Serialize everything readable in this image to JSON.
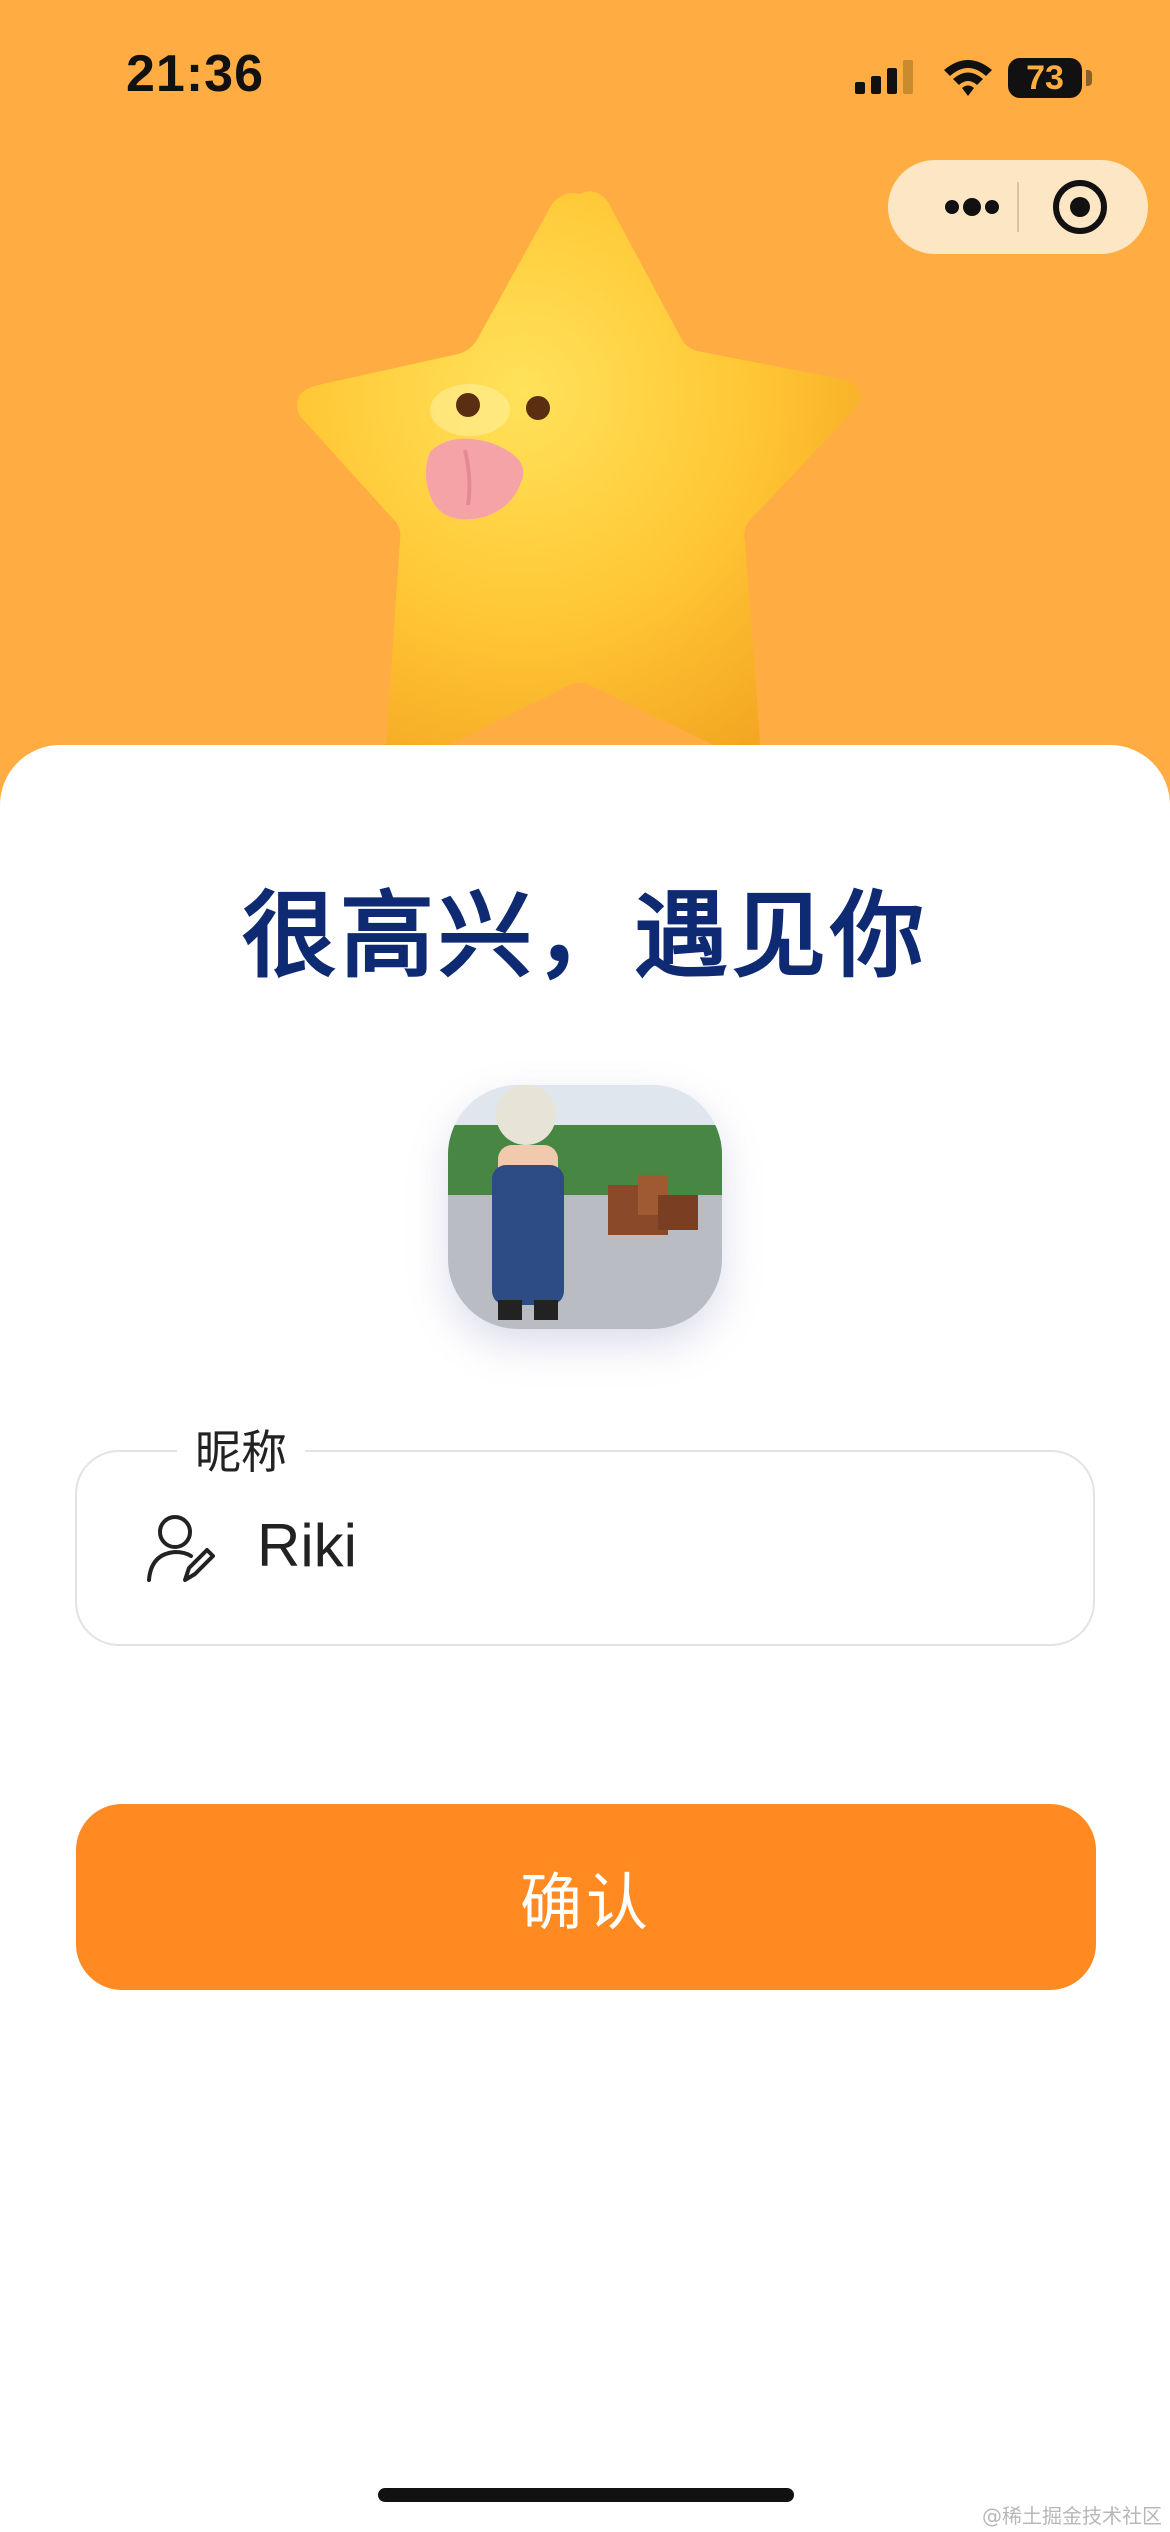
{
  "status_bar": {
    "time": "21:36",
    "battery": "73",
    "icons": [
      "signal-icon",
      "wifi-icon",
      "battery-icon"
    ]
  },
  "capsule": {
    "more_icon": "more-dots-icon",
    "close_icon": "target-close-icon"
  },
  "hero": {
    "illustration": "star-mascot"
  },
  "main": {
    "title": "很高兴，遇见你",
    "avatar_alt": "avatar-photo",
    "nickname": {
      "label": "昵称",
      "value": "Riki",
      "icon": "user-edit-icon"
    },
    "confirm_label": "确认"
  },
  "watermark": "@稀土掘金技术社区",
  "colors": {
    "header_bg": "#ffad42",
    "title": "#0e2a73",
    "button": "#ff8a22"
  }
}
